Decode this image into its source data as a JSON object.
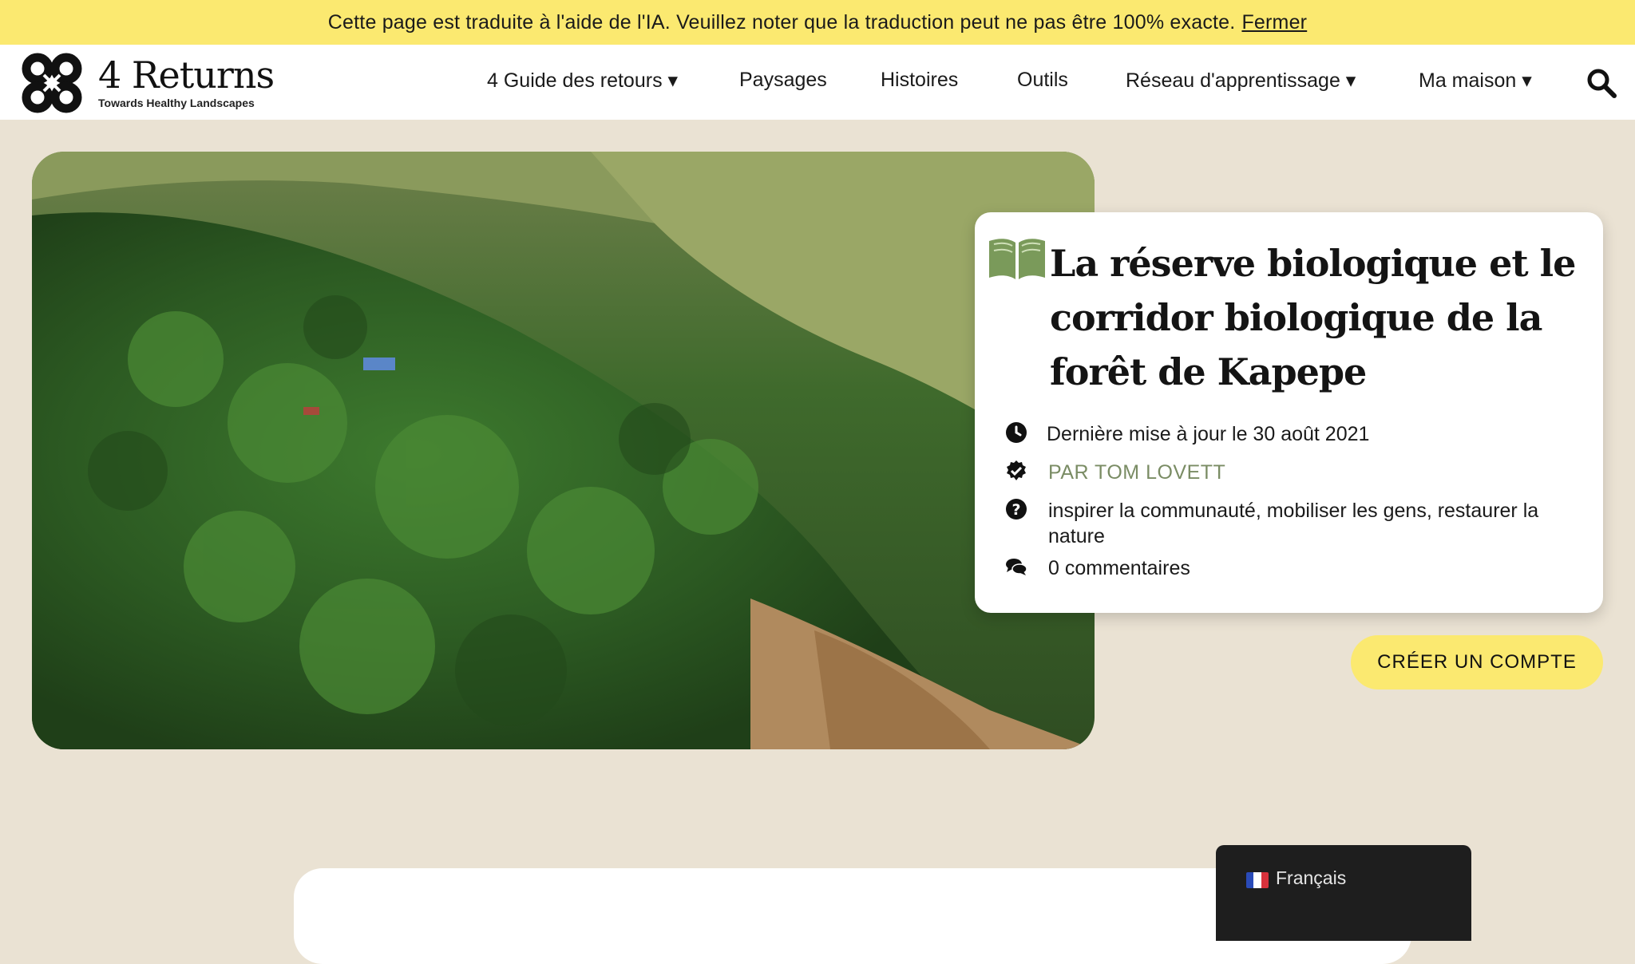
{
  "banner": {
    "message": "Cette page est traduite à l'aide de l'IA. Veuillez noter que la traduction peut ne pas être 100% exacte.",
    "close_label": "Fermer",
    "background": "#fbe970"
  },
  "logo": {
    "name": "4 Returns",
    "tagline": "Towards Healthy Landscapes",
    "icon": "knot-logo-icon"
  },
  "nav": {
    "items": [
      {
        "label": "4 Guide des retours ▾",
        "dropdown": true
      },
      {
        "label": "Paysages",
        "dropdown": false
      },
      {
        "label": "Histoires",
        "dropdown": false
      },
      {
        "label": "Outils",
        "dropdown": false
      },
      {
        "label": "Réseau d'apprentissage ▾",
        "dropdown": true
      },
      {
        "label": "Ma maison ▾",
        "dropdown": true
      }
    ],
    "search_icon": "search-icon"
  },
  "hero": {
    "image_subject": "aerial view of forested valley with hills"
  },
  "article": {
    "icon": "open-book-icon",
    "title": "La réserve biologique et le corridor biologique de la forêt de Kapepe",
    "updated": "Dernière mise à jour le 30 août 2021",
    "author": "PAR TOM LOVETT",
    "tags": "inspirer la communauté, mobiliser les gens, restaurer la nature",
    "comments": "0 commentaires",
    "accent_color": "#7a8c64"
  },
  "cta": {
    "label": "CRÉER UN COMPTE",
    "background": "#fbe970"
  },
  "language": {
    "label": "Français",
    "flag_icon": "france-flag-icon"
  },
  "colors": {
    "page_background": "#eae2d3",
    "header_background": "#ffffff"
  }
}
